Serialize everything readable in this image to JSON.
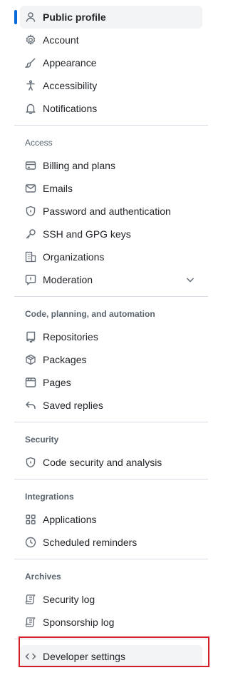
{
  "nav": {
    "top_items": [
      {
        "label": "Public profile",
        "icon": "person-icon"
      },
      {
        "label": "Account",
        "icon": "gear-icon"
      },
      {
        "label": "Appearance",
        "icon": "paintbrush-icon"
      },
      {
        "label": "Accessibility",
        "icon": "accessibility-icon"
      },
      {
        "label": "Notifications",
        "icon": "bell-icon"
      }
    ],
    "access": {
      "title": "Access",
      "items": [
        {
          "label": "Billing and plans",
          "icon": "credit-card-icon"
        },
        {
          "label": "Emails",
          "icon": "mail-icon"
        },
        {
          "label": "Password and authentication",
          "icon": "shield-lock-icon"
        },
        {
          "label": "SSH and GPG keys",
          "icon": "key-icon"
        },
        {
          "label": "Organizations",
          "icon": "organization-icon"
        },
        {
          "label": "Moderation",
          "icon": "report-icon"
        }
      ]
    },
    "code": {
      "title": "Code, planning, and automation",
      "items": [
        {
          "label": "Repositories",
          "icon": "repo-icon"
        },
        {
          "label": "Packages",
          "icon": "package-icon"
        },
        {
          "label": "Pages",
          "icon": "browser-icon"
        },
        {
          "label": "Saved replies",
          "icon": "reply-icon"
        }
      ]
    },
    "security": {
      "title": "Security",
      "items": [
        {
          "label": "Code security and analysis",
          "icon": "shield-lock-icon"
        }
      ]
    },
    "integrations": {
      "title": "Integrations",
      "items": [
        {
          "label": "Applications",
          "icon": "apps-icon"
        },
        {
          "label": "Scheduled reminders",
          "icon": "clock-icon"
        }
      ]
    },
    "archives": {
      "title": "Archives",
      "items": [
        {
          "label": "Security log",
          "icon": "log-icon"
        },
        {
          "label": "Sponsorship log",
          "icon": "log-icon"
        }
      ]
    },
    "developer": {
      "label": "Developer settings",
      "icon": "code-icon"
    }
  },
  "colors": {
    "accent": "#0969da",
    "highlight": "#d41e2a",
    "active_bg": "#f3f4f6"
  }
}
